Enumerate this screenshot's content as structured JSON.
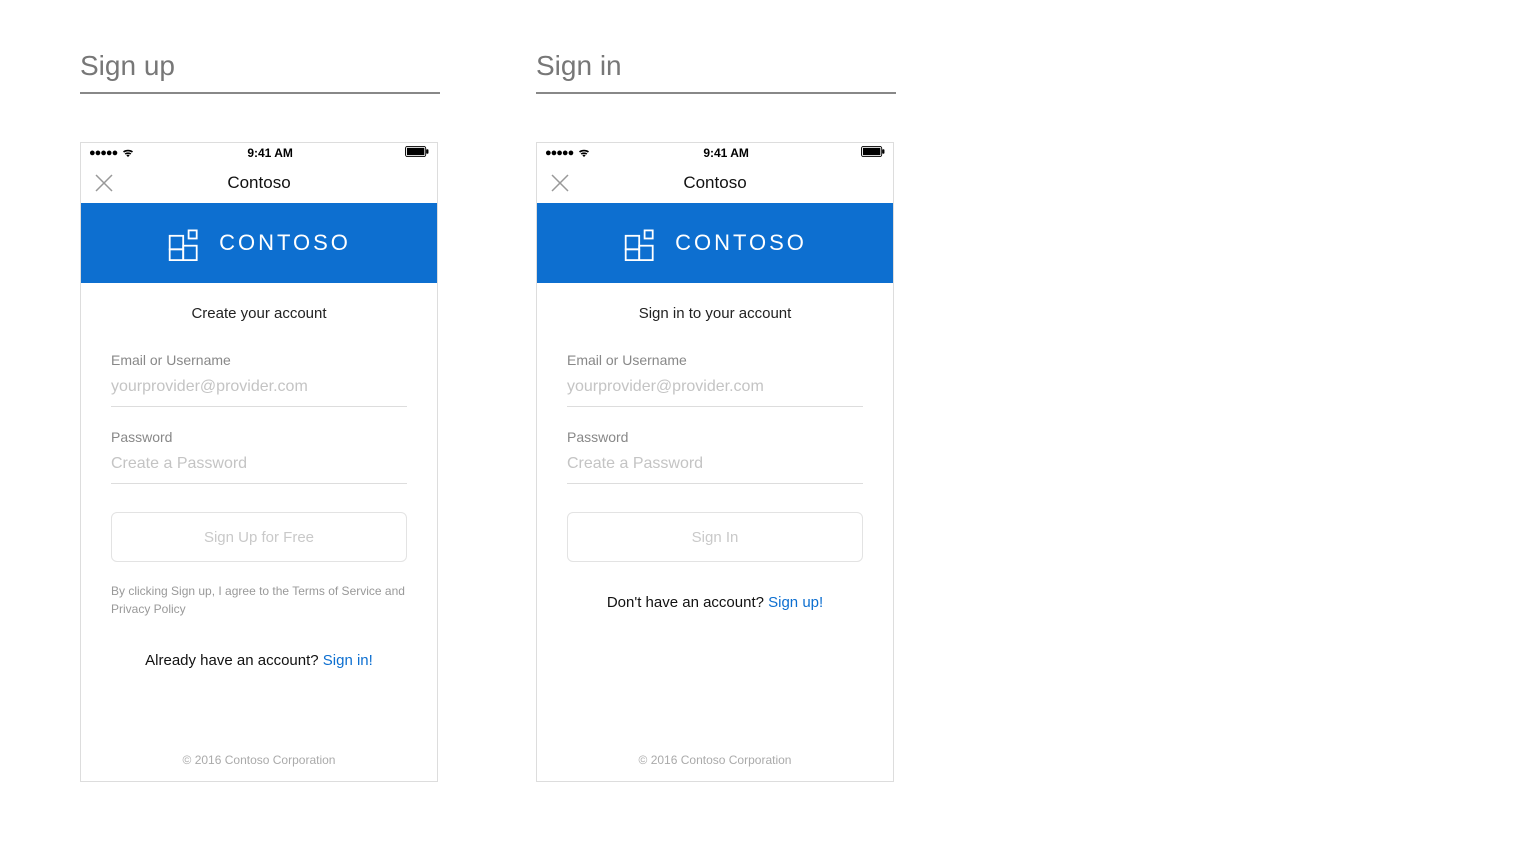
{
  "sections": {
    "signup_title": "Sign up",
    "signin_title": "Sign in"
  },
  "status_bar": {
    "dots": "●●●●●",
    "time": "9:41 AM"
  },
  "nav": {
    "title": "Contoso"
  },
  "brand": {
    "name": "CONTOSO"
  },
  "signup": {
    "subtitle": "Create your account",
    "email_label": "Email or Username",
    "email_placeholder": "yourprovider@provider.com",
    "password_label": "Password",
    "password_placeholder": "Create a Password",
    "button": "Sign Up for Free",
    "legal": "By clicking Sign up, I agree to the Terms of Service and Privacy Policy",
    "switch_prompt": "Already have an account? ",
    "switch_link": "Sign in!"
  },
  "signin": {
    "subtitle": "Sign in to your account",
    "email_label": "Email or Username",
    "email_placeholder": "yourprovider@provider.com",
    "password_label": "Password",
    "password_placeholder": "Create a Password",
    "button": "Sign In",
    "switch_prompt": "Don't have an account? ",
    "switch_link": "Sign up!"
  },
  "footer": {
    "copyright": "© 2016 Contoso Corporation"
  }
}
